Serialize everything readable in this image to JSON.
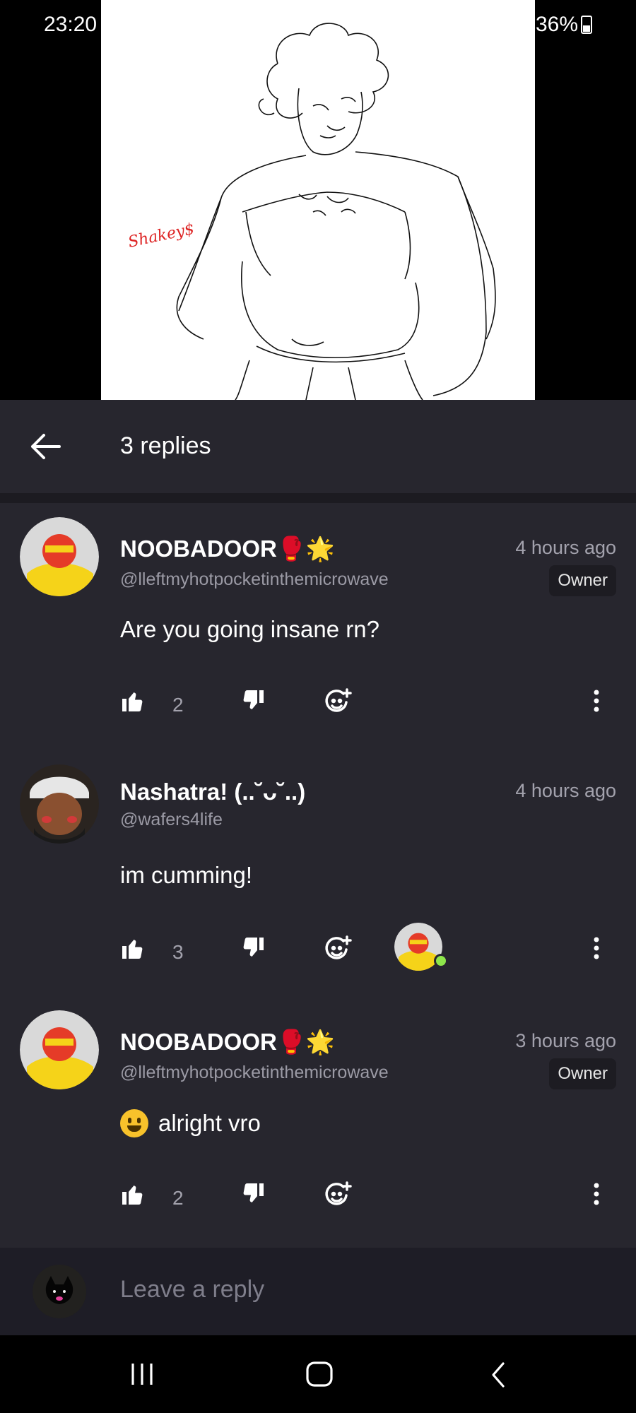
{
  "status_bar": {
    "time": "23:20",
    "battery": "36%"
  },
  "media": {
    "signature": "Shakey$"
  },
  "header": {
    "title": "3 replies",
    "back_icon": "arrow-left-icon"
  },
  "comments": [
    {
      "username": "NOOBADOOR🥊🌟",
      "handle": "@lleftmyhotpocketinthemicrowave",
      "time": "4 hours ago",
      "badge": "Owner",
      "body": "Are you going insane rn?",
      "likes": "2"
    },
    {
      "username": "Nashatra! (..˘ᴗ˘..)",
      "handle": "@wafers4life",
      "time": "4 hours ago",
      "body": "im cumming!",
      "likes": "3"
    },
    {
      "username": "NOOBADOOR🥊🌟",
      "handle": "@lleftmyhotpocketinthemicrowave",
      "time": "3 hours ago",
      "badge": "Owner",
      "body": "alright vro",
      "likes": "2"
    }
  ],
  "reply": {
    "placeholder": "Leave a reply"
  },
  "colors": {
    "panel": "#27262e",
    "reply_bar": "#1e1d26",
    "online": "#8ee64b"
  }
}
